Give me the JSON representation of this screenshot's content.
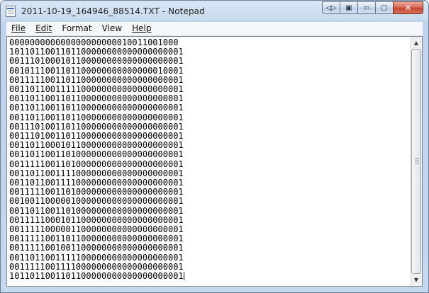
{
  "window": {
    "title": "2011-10-19_164946_88514.TXT - Notepad",
    "icon": "notepad-icon",
    "controls": {
      "extra_glyph": "◁▷",
      "snap_glyph": "▣",
      "minimize_glyph": "▭",
      "maximize_glyph": "▢",
      "close_glyph": "✕"
    }
  },
  "menu": [
    {
      "id": "file",
      "label": "File"
    },
    {
      "id": "edit",
      "label": "Edit"
    },
    {
      "id": "format",
      "label": "Format"
    },
    {
      "id": "view",
      "label": "View"
    },
    {
      "id": "help",
      "label": "Help"
    }
  ],
  "editor": {
    "lines": [
      "000000000000000000000010011001000",
      "1011011001101100000000000000000001",
      "0011101000101100000000000000000001",
      "0010111001101100000000000000010001",
      "0011111001101100000000000000000001",
      "0011011001111100000000000000000001",
      "0011011001101100000000000000000001",
      "0011011001101100000000000000000001",
      "0011011001101100000000000000000001",
      "0011101001101100000000000000000001",
      "0011101001101100000000000000000001",
      "0011011000101100000000000000000001",
      "0011011001101000000000000000000001",
      "0011111001101000000000000000000001",
      "0011011001111000000000000000000001",
      "0011011001111000000000000000000001",
      "0011111001101000000000000000000001",
      "0010011000001000000000000000000001",
      "0011011001101000000000000000000001",
      "0011111000101100000000000000000001",
      "0011111000001100000000000000000001",
      "0011111001101100000000000000000001",
      "0011111001001100000000000000000001",
      "0011011001111100000000000000000001",
      "0011111001111000000000000000000001",
      "1011011001101100000000000000000001"
    ]
  },
  "scrollbar": {
    "up_glyph": "▲",
    "down_glyph": "▼"
  }
}
